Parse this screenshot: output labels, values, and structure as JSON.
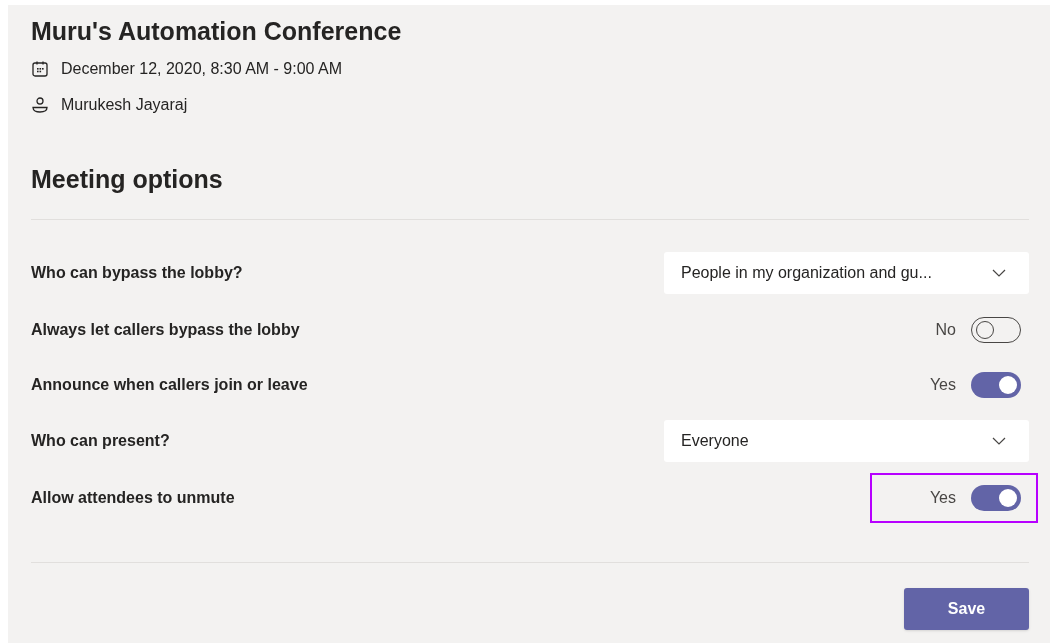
{
  "meeting": {
    "title": "Muru's Automation Conference",
    "datetime": "December 12, 2020, 8:30 AM - 9:00 AM",
    "organizer": "Murukesh Jayaraj"
  },
  "section_title": "Meeting options",
  "options": [
    {
      "kind": "dropdown",
      "label": "Who can bypass the lobby?",
      "value": "People in my organization and gu..."
    },
    {
      "kind": "toggle",
      "label": "Always let callers bypass the lobby",
      "state_text": "No",
      "on": false
    },
    {
      "kind": "toggle",
      "label": "Announce when callers join or leave",
      "state_text": "Yes",
      "on": true
    },
    {
      "kind": "dropdown",
      "label": "Who can present?",
      "value": "Everyone"
    },
    {
      "kind": "toggle",
      "label": "Allow attendees to unmute",
      "state_text": "Yes",
      "on": true,
      "highlighted": true
    }
  ],
  "save_button": "Save"
}
